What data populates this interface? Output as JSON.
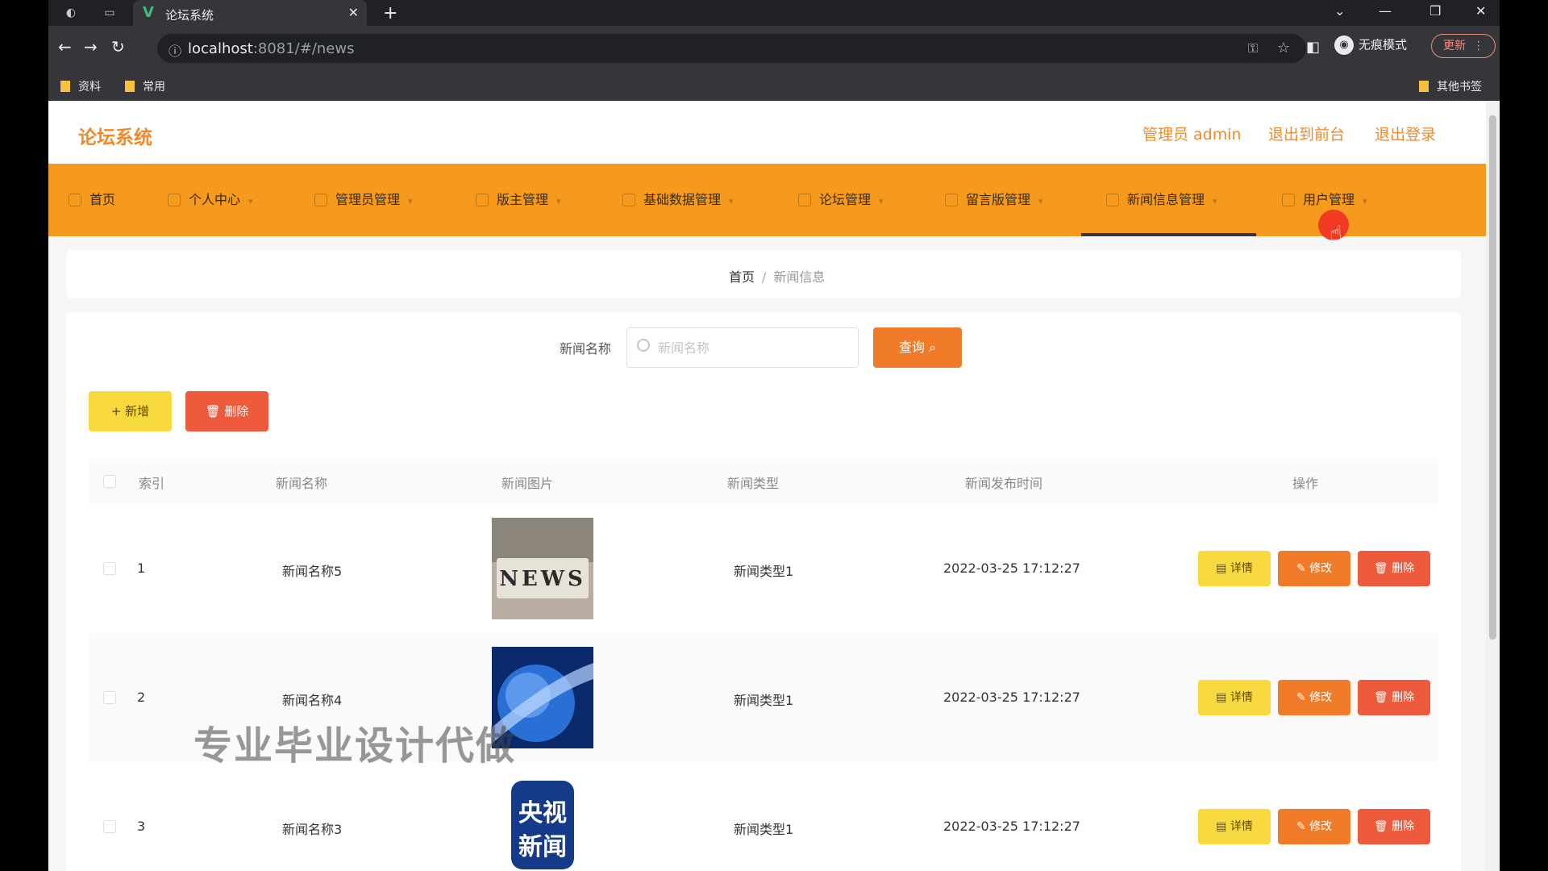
{
  "browser": {
    "tab_title": "论坛系统",
    "url_host": "localhost",
    "url_rest": ":8081/#/news",
    "incognito_label": "无痕模式",
    "update_label": "更新",
    "bookmarks": [
      "资料",
      "常用"
    ],
    "other_bookmarks": "其他书签"
  },
  "header": {
    "title": "论坛系统",
    "admin_label": "管理员 admin",
    "front_link": "退出到前台",
    "logout_link": "退出登录"
  },
  "menu": {
    "items": [
      "首页",
      "个人中心",
      "管理员管理",
      "版主管理",
      "基础数据管理",
      "论坛管理",
      "留言版管理",
      "新闻信息管理",
      "用户管理"
    ],
    "active": "新闻信息管理"
  },
  "breadcrumb": {
    "home": "首页",
    "sep": "/",
    "current": "新闻信息"
  },
  "search": {
    "label": "新闻名称",
    "placeholder": "新闻名称",
    "button": "查询"
  },
  "actions": {
    "add": "+ 新增",
    "delete": "删除"
  },
  "table": {
    "headers": [
      "索引",
      "新闻名称",
      "新闻图片",
      "新闻类型",
      "新闻发布时间",
      "操作"
    ],
    "rows": [
      {
        "index": "1",
        "name": "新闻名称5",
        "image_text": "NEWS",
        "type": "新闻类型1",
        "time": "2022-03-25 17:12:27"
      },
      {
        "index": "2",
        "name": "新闻名称4",
        "image_text": "",
        "type": "新闻类型1",
        "time": "2022-03-25 17:12:27"
      },
      {
        "index": "3",
        "name": "新闻名称3",
        "image_text": "央视新闻",
        "type": "新闻类型1",
        "time": "2022-03-25 17:12:27"
      }
    ],
    "ops": {
      "detail": "详情",
      "edit": "修改",
      "delete": "删除"
    }
  },
  "watermark": "专业毕业设计代做",
  "colors": {
    "accent": "#f59a1c",
    "title": "#f08a24",
    "warning": "#f8d93f",
    "danger": "#ee5a3c",
    "primary": "#f07c2a"
  }
}
